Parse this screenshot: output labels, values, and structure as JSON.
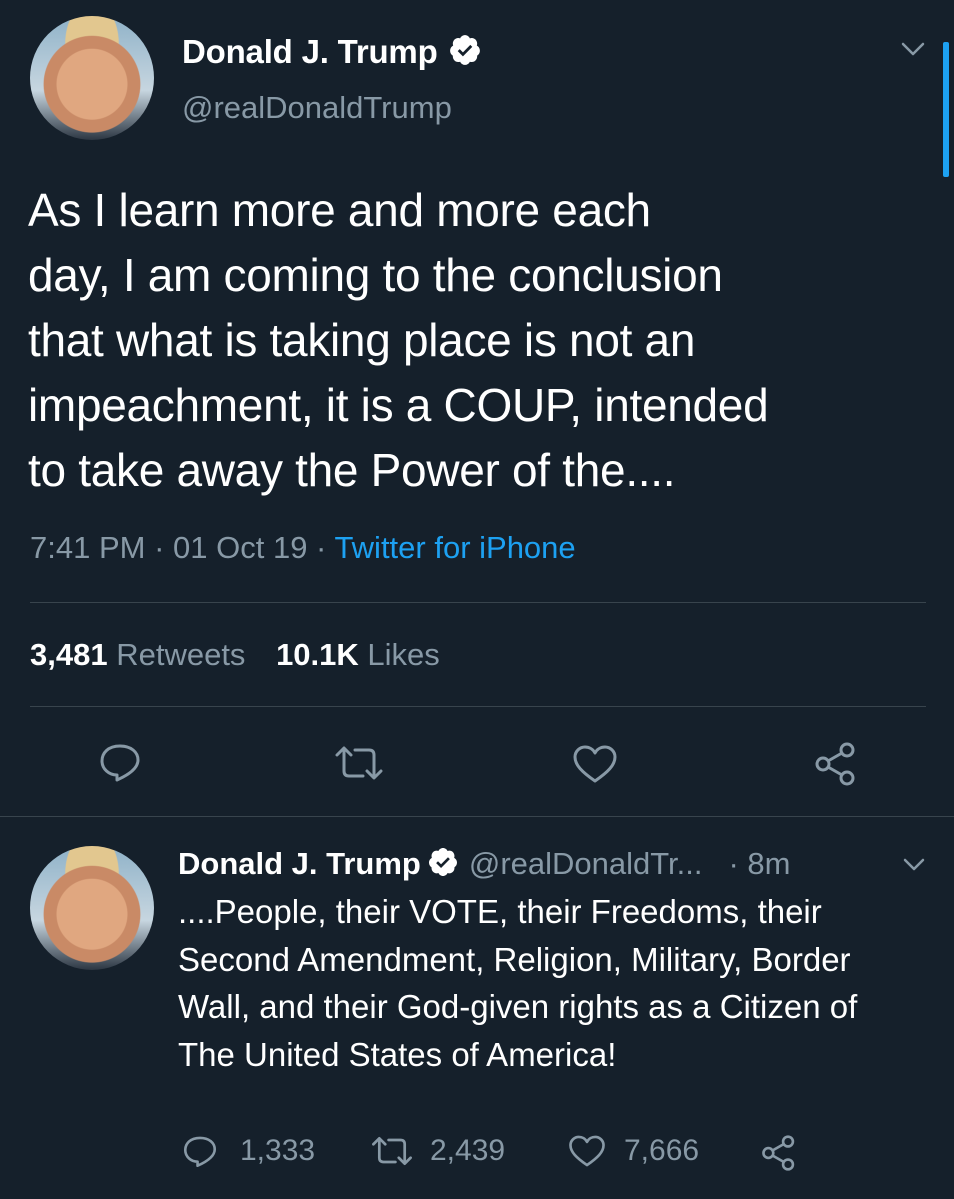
{
  "main_tweet": {
    "name": "Donald J. Trump",
    "handle": "@realDonaldTrump",
    "text_lines": [
      "As I learn more and more each",
      "day, I am coming to the conclusion",
      "that what is taking place is not an",
      "impeachment, it is a COUP, intended",
      "to take away the Power of the...."
    ],
    "time": "7:41 PM",
    "date": "01 Oct 19",
    "source": "Twitter for iPhone",
    "retweets_count": "3,481",
    "retweets_label": "Retweets",
    "likes_count": "10.1K",
    "likes_label": "Likes"
  },
  "reply_tweet": {
    "name": "Donald J. Trump",
    "handle": "@realDonaldTr...",
    "age": "· 8m",
    "text_lines": [
      "....People, their VOTE, their Freedoms, their",
      "Second Amendment, Religion, Military, Border",
      "Wall, and their God-given rights as a Citizen of",
      "The United States of America!"
    ],
    "reply_count": "1,333",
    "retweet_count": "2,439",
    "like_count": "7,666"
  },
  "colors": {
    "background": "#15202b",
    "accent": "#1da1f2",
    "muted": "#8899a6",
    "divider": "#38444d"
  },
  "icons": [
    "chevron-down-icon",
    "verified-icon",
    "reply-icon",
    "retweet-icon",
    "like-icon",
    "share-icon"
  ]
}
